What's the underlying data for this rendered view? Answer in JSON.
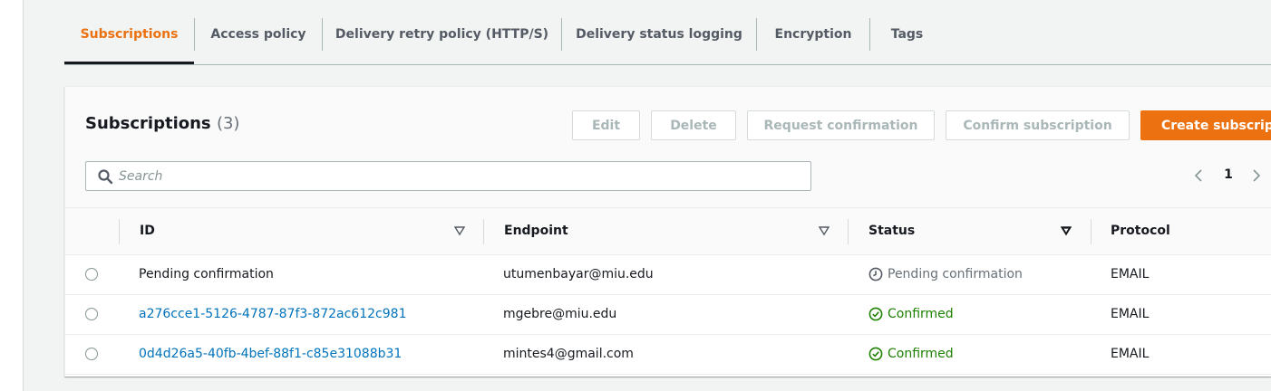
{
  "tabs": [
    {
      "label": "Subscriptions",
      "active": true
    },
    {
      "label": "Access policy",
      "active": false
    },
    {
      "label": "Delivery retry policy (HTTP/S)",
      "active": false
    },
    {
      "label": "Delivery status logging",
      "active": false
    },
    {
      "label": "Encryption",
      "active": false
    },
    {
      "label": "Tags",
      "active": false
    }
  ],
  "panel": {
    "title": "Subscriptions",
    "count": "(3)",
    "buttons": {
      "edit": "Edit",
      "delete": "Delete",
      "request_confirmation": "Request confirmation",
      "confirm_subscription": "Confirm subscription",
      "create_subscription": "Create subscript"
    },
    "search": {
      "placeholder": "Search",
      "value": ""
    },
    "pagination": {
      "current_page": "1"
    }
  },
  "table": {
    "columns": [
      "ID",
      "Endpoint",
      "Status",
      "Protocol"
    ],
    "rows": [
      {
        "id": "Pending confirmation",
        "id_is_link": false,
        "endpoint": "utumenbayar@miu.edu",
        "status": "Pending confirmation",
        "status_type": "pending",
        "protocol": "EMAIL"
      },
      {
        "id": "a276cce1-5126-4787-87f3-872ac612c981",
        "id_is_link": true,
        "endpoint": "mgebre@miu.edu",
        "status": "Confirmed",
        "status_type": "confirmed",
        "protocol": "EMAIL"
      },
      {
        "id": "0d4d26a5-40fb-4bef-88f1-c85e31088b31",
        "id_is_link": true,
        "endpoint": "mintes4@gmail.com",
        "status": "Confirmed",
        "status_type": "confirmed",
        "protocol": "EMAIL"
      }
    ]
  },
  "colors": {
    "accent": "#ec7211",
    "link": "#0073bb",
    "success": "#1d8102",
    "muted": "#687078",
    "disabled": "#aab7b8"
  },
  "icons": {
    "search": "search-icon",
    "sort": "caret-down-icon",
    "pending": "clock-icon",
    "confirmed": "check-circle-icon",
    "prev": "chevron-left-icon",
    "next": "chevron-right-icon"
  }
}
